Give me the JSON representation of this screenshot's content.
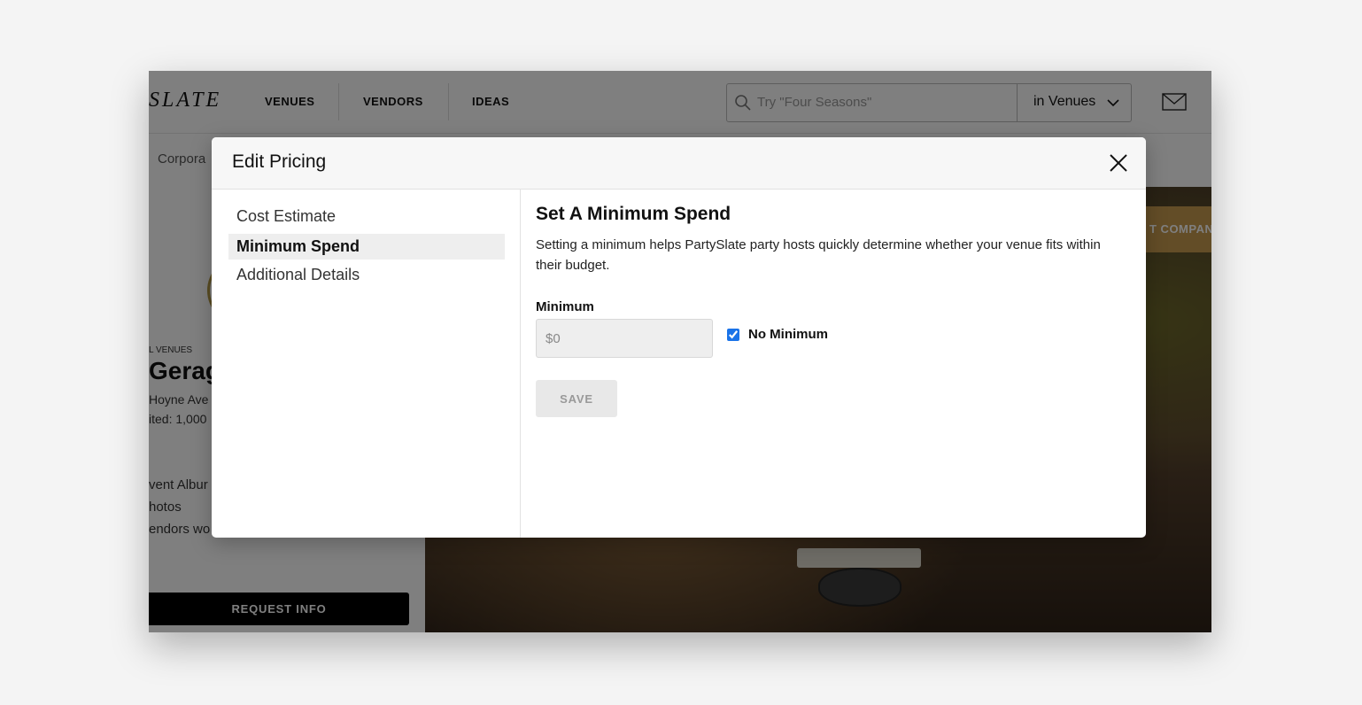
{
  "header": {
    "logo": "SLATE",
    "nav": [
      "VENUES",
      "VENDORS",
      "IDEAS"
    ],
    "search": {
      "placeholder": "Try \"Four Seasons\"",
      "scope": "in Venues"
    }
  },
  "subnav": {
    "text": "Corpora"
  },
  "venue": {
    "category": "L VENUES",
    "name": "Gerag",
    "address": "Hoyne Ave",
    "capacity": "ited: 1,000",
    "stats": [
      "vent Albur",
      "hotos",
      "endors wo"
    ],
    "request_label": "REQUEST INFO",
    "contact_label": "T COMPAN"
  },
  "modal": {
    "title": "Edit Pricing",
    "sidebar": {
      "items": [
        "Cost Estimate",
        "Minimum Spend",
        "Additional Details"
      ],
      "active_index": 1
    },
    "section": {
      "title": "Set A Minimum Spend",
      "description": "Setting a minimum helps PartySlate party hosts quickly determine whether your venue fits within their budget.",
      "minimum_label": "Minimum",
      "minimum_placeholder": "$0",
      "no_minimum_label": "No Minimum",
      "no_minimum_checked": true,
      "save_label": "SAVE"
    }
  },
  "colors": {
    "checkbox": "#1a73e8",
    "contact_button": "#c79a4f",
    "overlay": "rgba(0,0,0,0.5)"
  }
}
